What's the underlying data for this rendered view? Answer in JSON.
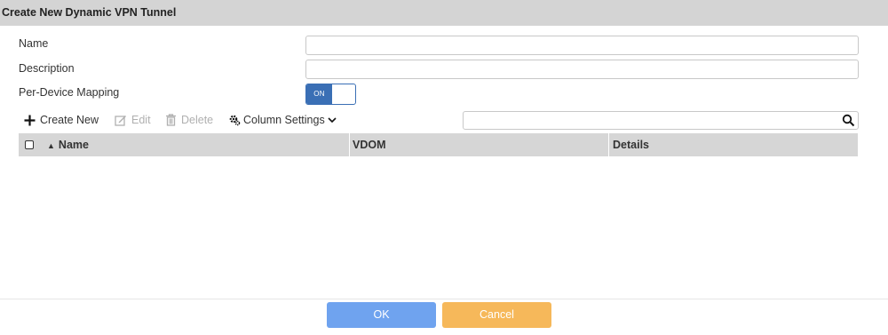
{
  "dialog": {
    "title": "Create New Dynamic VPN Tunnel"
  },
  "form": {
    "name": {
      "label": "Name",
      "value": "",
      "placeholder": ""
    },
    "description": {
      "label": "Description",
      "value": "",
      "placeholder": ""
    },
    "per_device_mapping": {
      "label": "Per-Device Mapping",
      "toggle_text": "ON",
      "enabled": true
    }
  },
  "toolbar": {
    "create_new": "Create New",
    "edit": "Edit",
    "delete": "Delete",
    "column_settings": "Column Settings",
    "search_value": ""
  },
  "table": {
    "columns": [
      "Name",
      "VDOM",
      "Details"
    ],
    "sort_indicator": "▲",
    "rows": []
  },
  "footer": {
    "ok_label": "OK",
    "cancel_label": "Cancel"
  },
  "colors": {
    "header_bg": "#d4d4d4",
    "toggle_on": "#3a6fb5",
    "ok_button": "#6fa3ef",
    "cancel_button": "#f6b85a"
  },
  "icons": {
    "create_new": "plus-icon",
    "edit": "edit-icon",
    "delete": "trash-icon",
    "column_settings": "gear-icon",
    "dropdown": "chevron-down-icon",
    "search": "search-icon"
  }
}
